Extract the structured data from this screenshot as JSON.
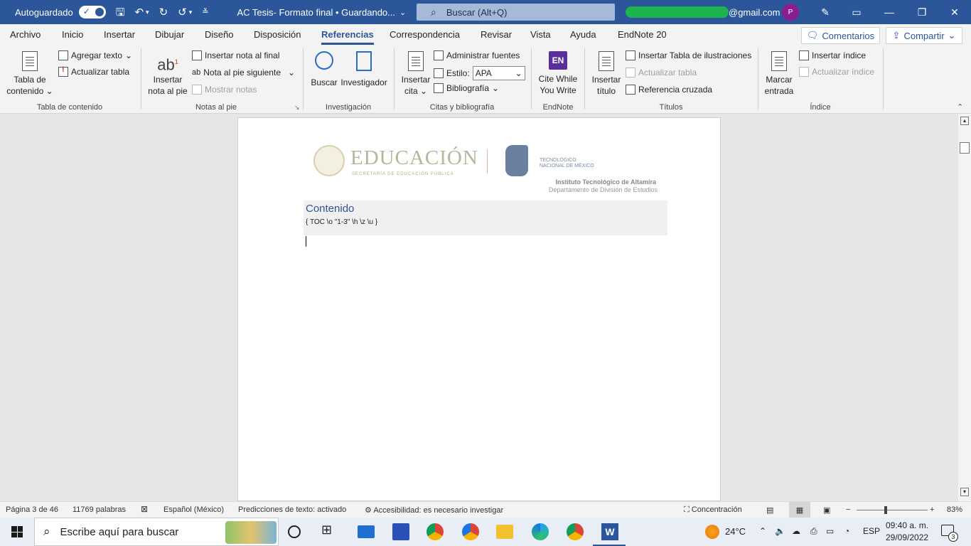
{
  "titlebar": {
    "autosave_label": "Autoguardado",
    "doc_title": "AC Tesis- Formato final • Guardando...",
    "search_placeholder": "Buscar (Alt+Q)",
    "account_suffix": "@gmail.com",
    "avatar_initial": "P"
  },
  "tabs": [
    "Archivo",
    "Inicio",
    "Insertar",
    "Dibujar",
    "Diseño",
    "Disposición",
    "Referencias",
    "Correspondencia",
    "Revisar",
    "Vista",
    "Ayuda",
    "EndNote 20"
  ],
  "active_tab": "Referencias",
  "comments_label": "Comentarios",
  "share_label": "Compartir",
  "ribbon": {
    "toc": {
      "big_label_1": "Tabla de",
      "big_label_2": "contenido",
      "add_text": "Agregar texto",
      "update_table": "Actualizar tabla",
      "group": "Tabla de contenido"
    },
    "footnotes": {
      "big_label_1": "Insertar",
      "big_label_2": "nota al pie",
      "insert_endnote": "Insertar nota al final",
      "next_footnote": "Nota al pie siguiente",
      "show_notes": "Mostrar notas",
      "group": "Notas al pie"
    },
    "research": {
      "search": "Buscar",
      "researcher": "Investigador",
      "group": "Investigación"
    },
    "citations": {
      "big_label_1": "Insertar",
      "big_label_2": "cita",
      "manage_sources": "Administrar fuentes",
      "style_label": "Estilo:",
      "style_value": "APA",
      "bibliography": "Bibliografía",
      "group": "Citas y bibliografía"
    },
    "endnote": {
      "label_1": "Cite While",
      "label_2": "You Write",
      "icon_text": "EN",
      "group": "EndNote"
    },
    "captions": {
      "big_label_1": "Insertar",
      "big_label_2": "título",
      "insert_table_figures": "Insertar Tabla de ilustraciones",
      "update_table": "Actualizar tabla",
      "cross_ref": "Referencia cruzada",
      "group": "Títulos"
    },
    "index": {
      "big_label_1": "Marcar",
      "big_label_2": "entrada",
      "insert_index": "Insertar índice",
      "update_index": "Actualizar índice",
      "group": "Índice"
    }
  },
  "document": {
    "logo_main": "EDUCACIÓN",
    "logo_sub": "SECRETARÍA DE EDUCACIÓN PÚBLICA",
    "tecnm_1": "TECNOLÓGICO",
    "tecnm_2": "NACIONAL DE MÉXICO",
    "institute": "Instituto Tecnológico de Altamira",
    "department": "Departamento de División de Estudios",
    "toc_heading": "Contenido",
    "toc_field_code": "{ TOC \\o \"1-3\" \\h \\z \\u }"
  },
  "statusbar": {
    "page": "Página 3 de 46",
    "words": "11769 palabras",
    "language": "Español (México)",
    "predictions": "Predicciones de texto: activado",
    "accessibility": "Accesibilidad: es necesario investigar",
    "focus": "Concentración",
    "zoom": "83%"
  },
  "taskbar": {
    "search_placeholder": "Escribe aquí para buscar",
    "temperature": "24°C",
    "lang": "ESP",
    "time": "09:40 a. m.",
    "date": "29/09/2022",
    "notifications": "3"
  },
  "colors": {
    "word_blue": "#2b579a",
    "endnote_purple": "#5b2f9b",
    "avatar": "#8b1e8f"
  }
}
